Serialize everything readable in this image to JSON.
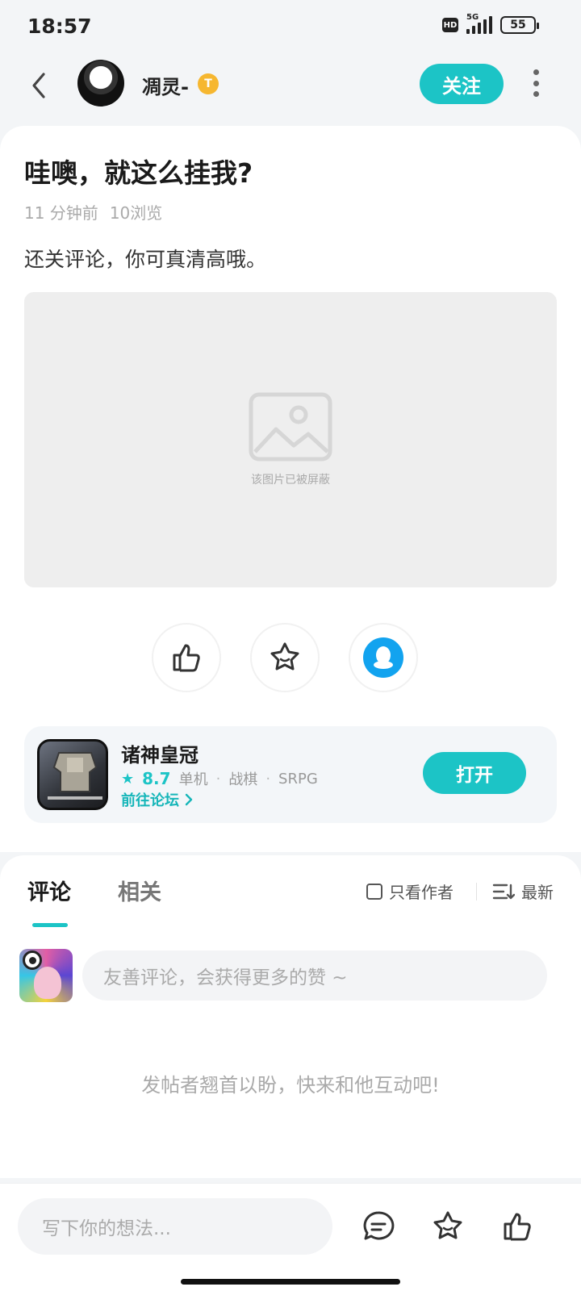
{
  "status_bar": {
    "time": "18:57",
    "hd_label": "HD",
    "network": "5G",
    "battery": "55"
  },
  "header": {
    "username": "凋灵-",
    "badge": "T",
    "follow_label": "关注"
  },
  "post": {
    "title": "哇噢，就这么挂我?",
    "time_ago": "11 分钟前",
    "views": "10浏览",
    "content": "还关评论，你可真清高哦。",
    "image_blocked_text": "该图片已被屏蔽"
  },
  "game": {
    "name": "诸神皇冠",
    "rating": "8.7",
    "tags": [
      "单机",
      "战棋",
      "SRPG"
    ],
    "forum_link": "前往论坛",
    "open_label": "打开"
  },
  "comments": {
    "tabs": [
      "评论",
      "相关"
    ],
    "only_author": "只看作者",
    "sort_label": "最新",
    "input_placeholder": "友善评论，会获得更多的赞 ~",
    "empty_text": "发帖者翘首以盼，快来和他互动吧!"
  },
  "bottom_bar": {
    "input_placeholder": "写下你的想法..."
  },
  "colors": {
    "accent": "#1cc4c6",
    "qq_blue": "#12a3ef",
    "badge_gold": "#f6b730"
  }
}
